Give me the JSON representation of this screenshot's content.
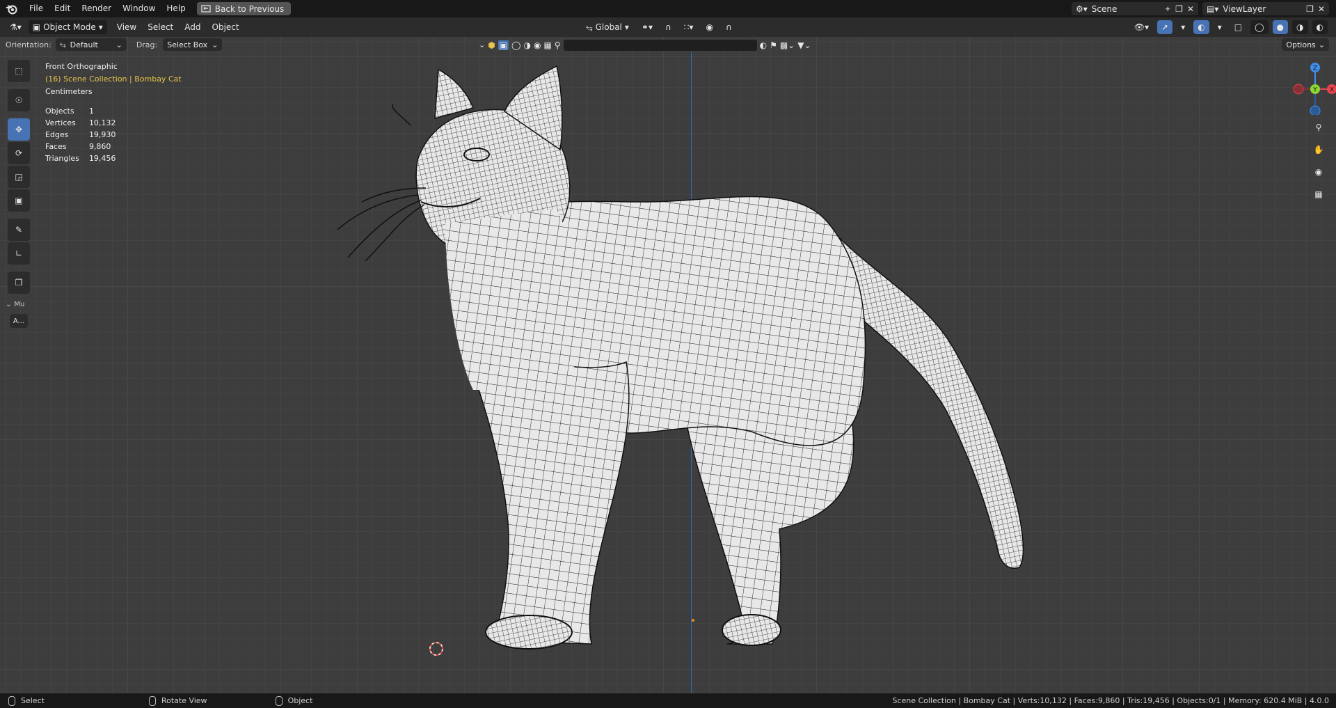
{
  "menubar": {
    "items": [
      "File",
      "Edit",
      "Render",
      "Window",
      "Help"
    ],
    "back_button": "Back to Previous",
    "scene_name": "Scene",
    "view_layer": "ViewLayer"
  },
  "header": {
    "mode": "Object Mode",
    "menus": [
      "View",
      "Select",
      "Add",
      "Object"
    ],
    "transform_orientation": "Global"
  },
  "tool_settings": {
    "orientation_label": "Orientation:",
    "orientation_value": "Default",
    "drag_label": "Drag:",
    "drag_value": "Select Box",
    "options_label": "Options"
  },
  "search": {
    "placeholder": ""
  },
  "toolbar": {
    "collapsed_label": "Mu",
    "add_label": "A..."
  },
  "overlay": {
    "view_name": "Front Orthographic",
    "collection_path": "(16) Scene Collection | Bombay Cat",
    "units": "Centimeters",
    "stats": [
      {
        "label": "Objects",
        "value": "1"
      },
      {
        "label": "Vertices",
        "value": "10,132"
      },
      {
        "label": "Edges",
        "value": "19,930"
      },
      {
        "label": "Faces",
        "value": "9,860"
      },
      {
        "label": "Triangles",
        "value": "19,456"
      }
    ]
  },
  "gizmo": {
    "z_label": "Z",
    "y_label": "Y",
    "x_label": "X",
    "colors": {
      "x": "#e8434f",
      "y": "#8bd534",
      "z": "#3f8de6"
    }
  },
  "statusbar": {
    "hints": [
      "Select",
      "Rotate View",
      "Object"
    ],
    "info": "Scene Collection | Bombay Cat | Verts:10,132 | Faces:9,860 | Tris:19,456 | Objects:0/1 | Memory: 620.4 MiB | 4.0.0"
  },
  "colors": {
    "accent": "#4772b3",
    "viewport_bg": "#3d3d3d"
  }
}
